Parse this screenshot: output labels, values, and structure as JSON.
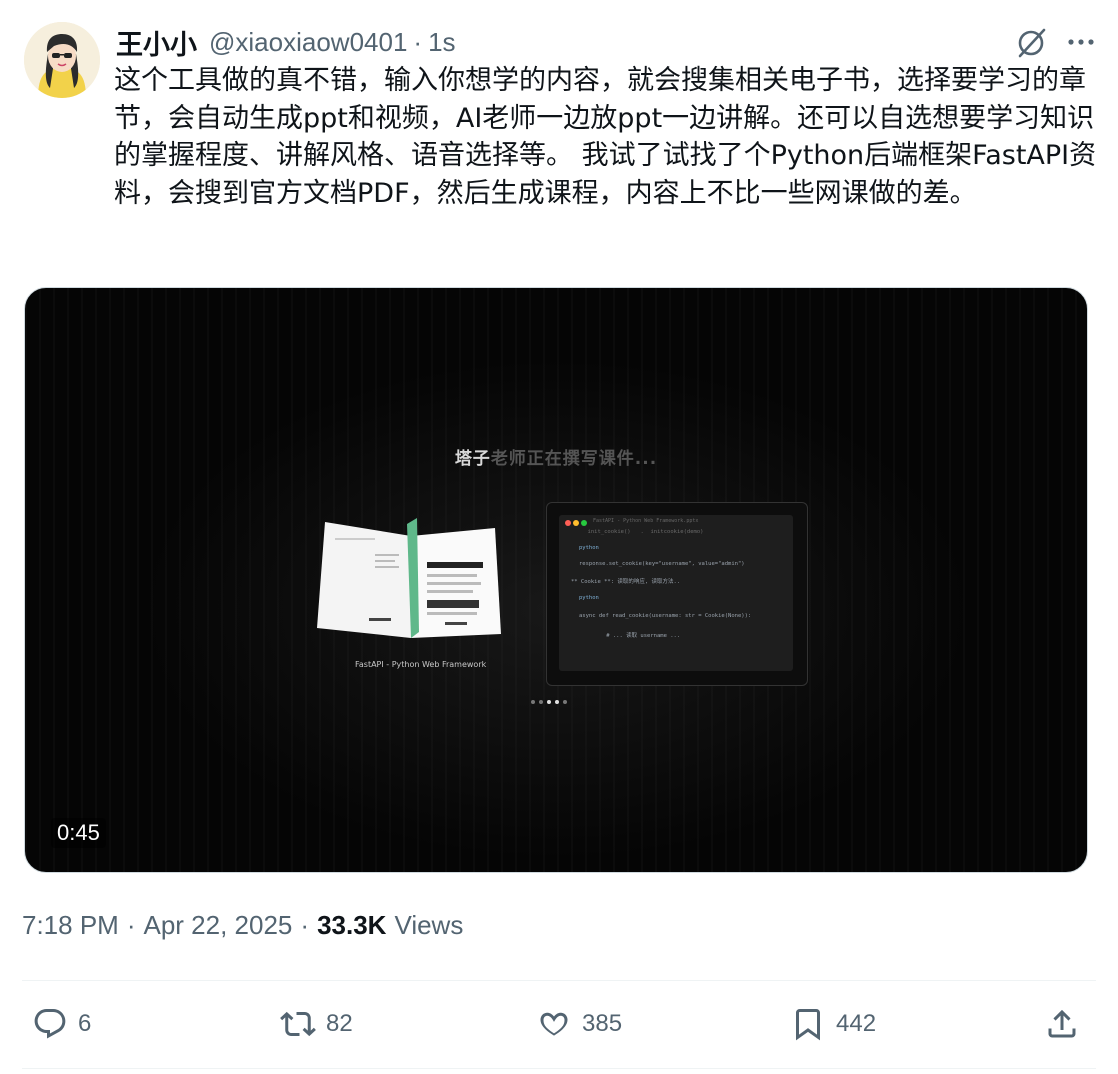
{
  "tweet": {
    "author": {
      "display_name": "王小小",
      "handle": "@xiaoxiaow0401",
      "separator": "·",
      "time_ago": "1s"
    },
    "text": "这个工具做的真不错，输入你想学的内容，就会搜集相关电子书，选择要学习的章节，会自动生成ppt和视频，AI老师一边放ppt一边讲解。还可以自选想要学习知识的掌握程度、讲解风格、语音选择等。 我试了试找了个Python后端框架FastAPI资料，会搜到官方文档PDF，然后生成课程，内容上不比一些网课做的差。",
    "video": {
      "caption_highlight": "塔子",
      "caption_rest": "老师正在撰写课件...",
      "book_label": "FastAPI - Python Web Framework",
      "code_window_title": "FastAPI - Python Web Framework.pptx",
      "code_lines": [
        "     init_cookie()   .  initcookie(demo)",
        "python",
        "response.set_cookie(key=\"username\", value=\"admin\")",
        "** Cookie **: 读取的响应, 读取方法..",
        "python",
        "async def read_cookie(username: str = Cookie(None)):",
        "    # ... 读取 username ..."
      ],
      "duration": "0:45"
    },
    "meta": {
      "timestamp": "7:18 PM",
      "date": "Apr 22, 2025",
      "separator": "·",
      "views_count": "33.3K",
      "views_label": "Views"
    },
    "actions": {
      "replies": "6",
      "retweets": "82",
      "likes": "385",
      "bookmarks": "442"
    }
  },
  "icons": {
    "grok": "grok-icon",
    "more": "more-icon",
    "reply": "reply-icon",
    "retweet": "retweet-icon",
    "like": "heart-icon",
    "bookmark": "bookmark-icon",
    "share": "share-icon"
  },
  "colors": {
    "text_primary": "#0f1419",
    "text_secondary": "#536471",
    "divider": "#eff3f4",
    "video_bg": "#050505"
  }
}
